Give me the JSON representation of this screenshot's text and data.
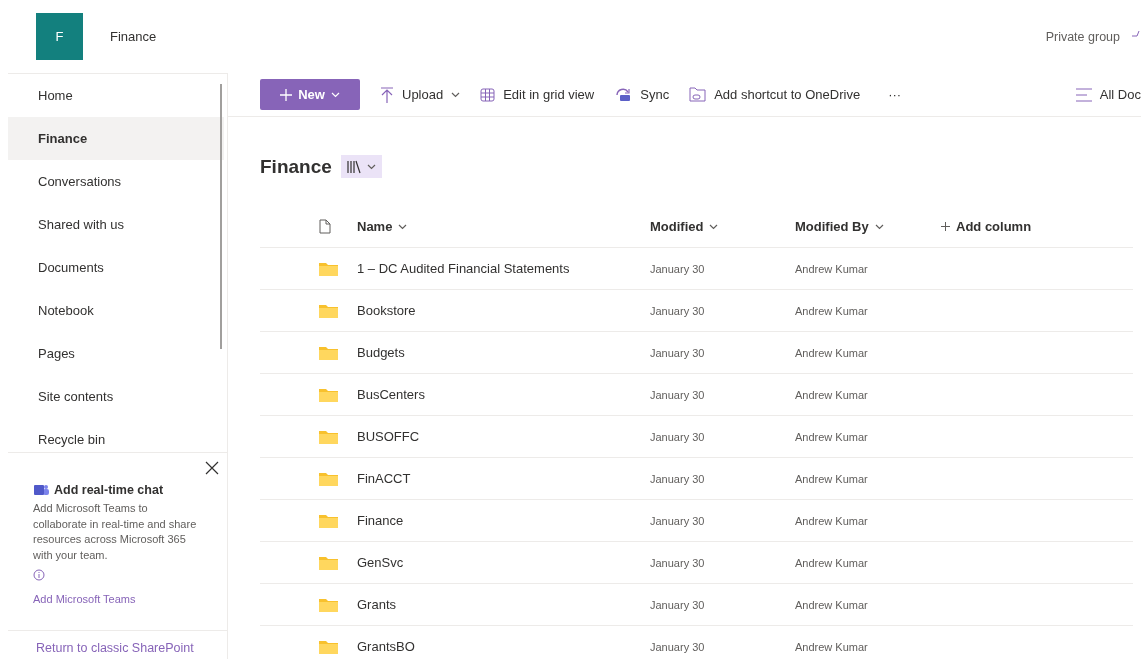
{
  "site": {
    "logo_letter": "F",
    "name": "Finance",
    "privacy": "Private group"
  },
  "nav": {
    "items": [
      {
        "label": "Home",
        "selected": false
      },
      {
        "label": "Finance",
        "selected": true
      },
      {
        "label": "Conversations",
        "selected": false
      },
      {
        "label": "Shared with us",
        "selected": false
      },
      {
        "label": "Documents",
        "selected": false
      },
      {
        "label": "Notebook",
        "selected": false
      },
      {
        "label": "Pages",
        "selected": false
      },
      {
        "label": "Site contents",
        "selected": false
      },
      {
        "label": "Recycle bin",
        "selected": false
      }
    ]
  },
  "teams_panel": {
    "title": "Add real-time chat",
    "body": "Add Microsoft Teams to collaborate in real-time and share resources across Microsoft 365 with your team.",
    "link": "Add Microsoft Teams"
  },
  "return_link": "Return to classic SharePoint",
  "toolbar": {
    "new_label": "New",
    "items": [
      {
        "kind": "upload",
        "label": "Upload",
        "dropdown": true
      },
      {
        "kind": "grid",
        "label": "Edit in grid view",
        "dropdown": false
      },
      {
        "kind": "sync",
        "label": "Sync",
        "dropdown": false
      },
      {
        "kind": "shortcut",
        "label": "Add shortcut to OneDrive",
        "dropdown": false
      }
    ],
    "more": "···",
    "view": "All Doc"
  },
  "library": {
    "title": "Finance"
  },
  "table": {
    "columns": [
      {
        "label": "Name"
      },
      {
        "label": "Modified"
      },
      {
        "label": "Modified By"
      }
    ],
    "add_column": "Add column",
    "rows": [
      {
        "name": "1 – DC Audited Financial Statements",
        "modified": "January 30",
        "modified_by": "Andrew Kumar"
      },
      {
        "name": "Bookstore",
        "modified": "January 30",
        "modified_by": "Andrew Kumar"
      },
      {
        "name": "Budgets",
        "modified": "January 30",
        "modified_by": "Andrew Kumar"
      },
      {
        "name": "BusCenters",
        "modified": "January 30",
        "modified_by": "Andrew Kumar"
      },
      {
        "name": "BUSOFFC",
        "modified": "January 30",
        "modified_by": "Andrew Kumar"
      },
      {
        "name": "FinACCT",
        "modified": "January 30",
        "modified_by": "Andrew Kumar"
      },
      {
        "name": "Finance",
        "modified": "January 30",
        "modified_by": "Andrew Kumar"
      },
      {
        "name": "GenSvc",
        "modified": "January 30",
        "modified_by": "Andrew Kumar"
      },
      {
        "name": "Grants",
        "modified": "January 30",
        "modified_by": "Andrew Kumar"
      },
      {
        "name": "GrantsBO",
        "modified": "January 30",
        "modified_by": "Andrew Kumar"
      }
    ]
  }
}
